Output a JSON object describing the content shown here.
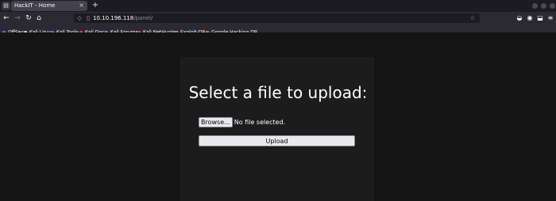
{
  "browser": {
    "app_icon": "files-icon",
    "tab": {
      "title": "HackIT - Home",
      "close_glyph": "×"
    },
    "new_tab_glyph": "+",
    "nav": {
      "back_glyph": "←",
      "forward_glyph": "→",
      "reload_glyph": "↻",
      "home_glyph": "⌂"
    },
    "url": {
      "host": "10.10.196.118",
      "path": "/panel/"
    },
    "bookmarks": [
      {
        "label": "OffSec",
        "color": "#3b82f6"
      },
      {
        "label": "Kali Linux",
        "color": "#d4d4d8"
      },
      {
        "label": "Kali Tools",
        "color": "#3b82f6"
      },
      {
        "label": "Kali Docs",
        "color": "#ef4444"
      },
      {
        "label": "Kali Forums",
        "color": "#3b82f6"
      },
      {
        "label": "Kali NetHunter",
        "color": "#ef4444"
      },
      {
        "label": "Exploit-DB",
        "color": "#f97316"
      },
      {
        "label": "Google Hacking DB",
        "color": "#f97316"
      }
    ]
  },
  "page": {
    "heading": "Select a file to upload:",
    "browse_label": "Browse...",
    "file_status": "No file selected.",
    "upload_label": "Upload"
  }
}
